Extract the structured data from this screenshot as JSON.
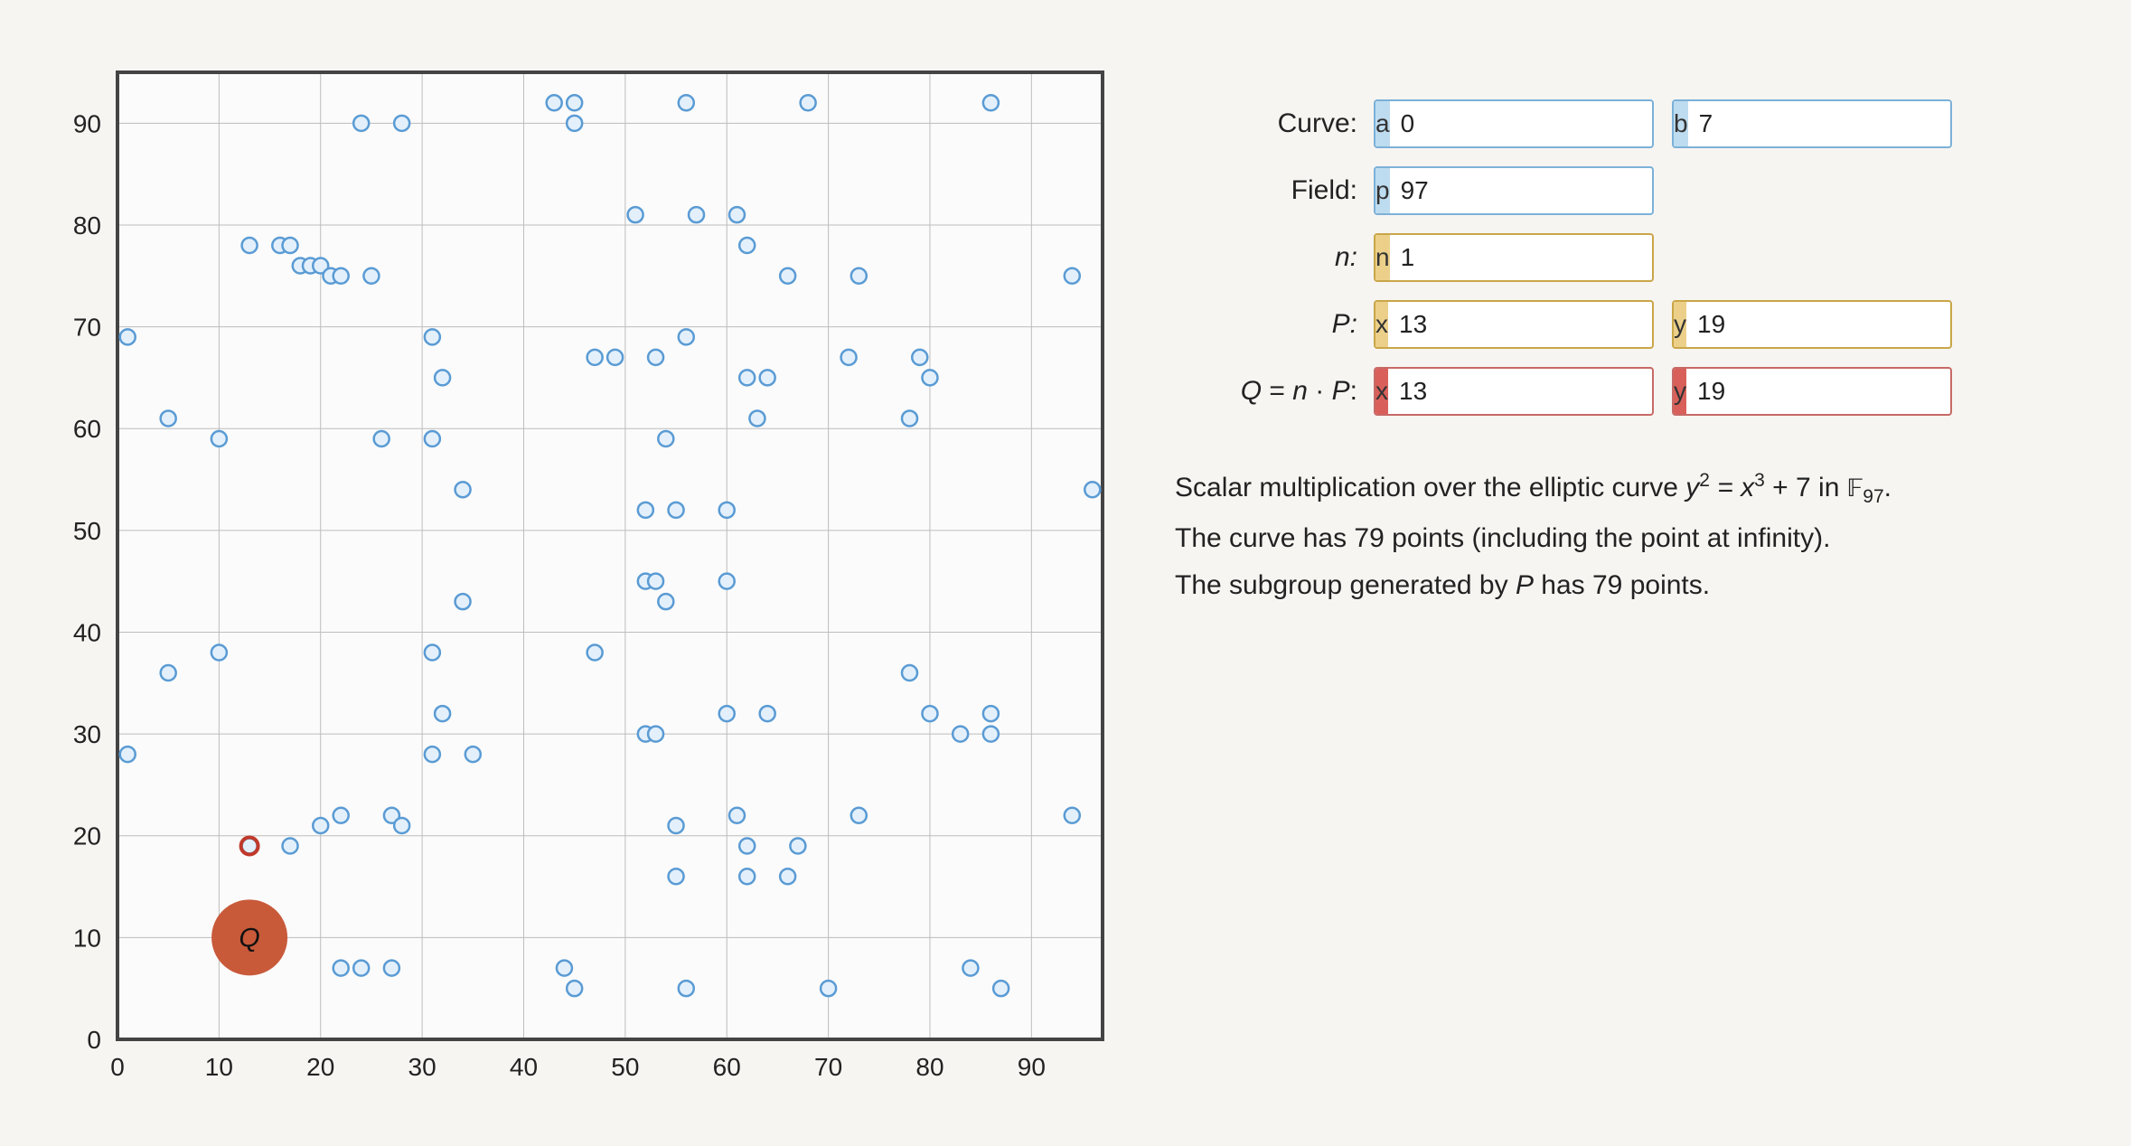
{
  "form": {
    "labels": {
      "curve": "Curve:",
      "field": "Field:",
      "n": "n:",
      "P": "P:",
      "Q": "Q = n · P:"
    },
    "curve": {
      "a_tag": "a",
      "a_val": "0",
      "b_tag": "b",
      "b_val": "7"
    },
    "field": {
      "p_tag": "p",
      "p_val": "97"
    },
    "n": {
      "n_tag": "n",
      "n_val": "1"
    },
    "P": {
      "x_tag": "x",
      "x_val": "13",
      "y_tag": "y",
      "y_val": "19"
    },
    "Q": {
      "x_tag": "x",
      "x_val": "13",
      "y_tag": "y",
      "y_val": "19"
    }
  },
  "desc": {
    "line1_a": "Scalar multiplication over the elliptic curve ",
    "line1_eq_lhs": "y",
    "line1_eq_exp1": "2",
    "line1_eq_mid": " = x",
    "line1_eq_exp2": "3",
    "line1_eq_rhs": " + 7",
    "line1_b": " in ",
    "line1_F": "𝔽",
    "line1_Fsub": "97",
    "line1_end": ".",
    "line2": "The curve has 79 points (including the point at infinity).",
    "line3": "The subgroup generated by P has 79 points."
  },
  "chart_data": {
    "type": "scatter",
    "title": "",
    "xlabel": "",
    "ylabel": "",
    "xlim": [
      0,
      97
    ],
    "ylim": [
      0,
      95
    ],
    "xticks": [
      0,
      10,
      20,
      30,
      40,
      50,
      60,
      70,
      80,
      90
    ],
    "yticks": [
      0,
      10,
      20,
      30,
      40,
      50,
      60,
      70,
      80,
      90
    ],
    "grid": true,
    "series": [
      {
        "name": "curve-points",
        "marker": "open-circle-blue",
        "points": [
          [
            1,
            28
          ],
          [
            1,
            69
          ],
          [
            5,
            36
          ],
          [
            5,
            61
          ],
          [
            10,
            59
          ],
          [
            10,
            38
          ],
          [
            13,
            19
          ],
          [
            13,
            78
          ],
          [
            16,
            78
          ],
          [
            17,
            19
          ],
          [
            17,
            78
          ],
          [
            18,
            76
          ],
          [
            19,
            76
          ],
          [
            20,
            21
          ],
          [
            20,
            76
          ],
          [
            21,
            75
          ],
          [
            22,
            75
          ],
          [
            22,
            22
          ],
          [
            22,
            7
          ],
          [
            24,
            90
          ],
          [
            24,
            7
          ],
          [
            25,
            75
          ],
          [
            26,
            59
          ],
          [
            27,
            22
          ],
          [
            27,
            7
          ],
          [
            28,
            21
          ],
          [
            28,
            90
          ],
          [
            31,
            59
          ],
          [
            31,
            38
          ],
          [
            31,
            28
          ],
          [
            31,
            69
          ],
          [
            32,
            65
          ],
          [
            32,
            32
          ],
          [
            34,
            43
          ],
          [
            34,
            54
          ],
          [
            35,
            28
          ],
          [
            43,
            92
          ],
          [
            44,
            7
          ],
          [
            45,
            92
          ],
          [
            45,
            90
          ],
          [
            45,
            5
          ],
          [
            47,
            38
          ],
          [
            47,
            67
          ],
          [
            49,
            67
          ],
          [
            51,
            81
          ],
          [
            52,
            30
          ],
          [
            52,
            45
          ],
          [
            52,
            52
          ],
          [
            53,
            30
          ],
          [
            53,
            45
          ],
          [
            53,
            67
          ],
          [
            54,
            59
          ],
          [
            54,
            43
          ],
          [
            55,
            52
          ],
          [
            55,
            21
          ],
          [
            55,
            16
          ],
          [
            56,
            5
          ],
          [
            56,
            69
          ],
          [
            56,
            92
          ],
          [
            57,
            81
          ],
          [
            60,
            52
          ],
          [
            60,
            45
          ],
          [
            60,
            32
          ],
          [
            61,
            22
          ],
          [
            61,
            81
          ],
          [
            62,
            19
          ],
          [
            62,
            78
          ],
          [
            62,
            65
          ],
          [
            62,
            16
          ],
          [
            63,
            61
          ],
          [
            64,
            65
          ],
          [
            64,
            32
          ],
          [
            66,
            75
          ],
          [
            66,
            16
          ],
          [
            67,
            19
          ],
          [
            68,
            92
          ],
          [
            70,
            5
          ],
          [
            72,
            67
          ],
          [
            73,
            22
          ],
          [
            73,
            75
          ],
          [
            78,
            61
          ],
          [
            78,
            36
          ],
          [
            79,
            67
          ],
          [
            80,
            65
          ],
          [
            80,
            32
          ],
          [
            83,
            30
          ],
          [
            84,
            7
          ],
          [
            86,
            30
          ],
          [
            86,
            32
          ],
          [
            86,
            92
          ],
          [
            87,
            5
          ],
          [
            94,
            75
          ],
          [
            94,
            22
          ],
          [
            96,
            54
          ]
        ]
      },
      {
        "name": "P",
        "marker": "ring-red",
        "points": [
          [
            13,
            19
          ]
        ]
      },
      {
        "name": "Q",
        "marker": "disc-orange-label",
        "label": "Q",
        "points_label_offset": [
          0,
          0
        ],
        "points": [
          [
            13,
            10
          ]
        ]
      }
    ]
  }
}
